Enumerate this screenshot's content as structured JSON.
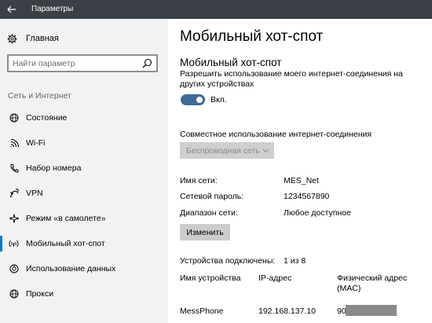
{
  "window": {
    "title": "Параметры"
  },
  "sidebar": {
    "home_label": "Главная",
    "search_placeholder": "Найти параметр",
    "section_title": "Сеть и Интернет",
    "items": [
      {
        "label": "Состояние",
        "icon": "globe-icon"
      },
      {
        "label": "Wi-Fi",
        "icon": "wifi-icon"
      },
      {
        "label": "Набор номера",
        "icon": "phone-icon"
      },
      {
        "label": "VPN",
        "icon": "vpn-icon"
      },
      {
        "label": "Режим «в самолете»",
        "icon": "airplane-icon"
      },
      {
        "label": "Мобильный хот-спот",
        "icon": "hotspot-icon",
        "active": true
      },
      {
        "label": "Использование данных",
        "icon": "data-usage-icon"
      },
      {
        "label": "Прокси",
        "icon": "globe-icon"
      }
    ]
  },
  "main": {
    "page_title": "Мобильный хот-спот",
    "sub_title": "Мобильный хот-спот",
    "description": "Разрешить использование моего интернет-соединения на других устройствах",
    "toggle": {
      "state": "on",
      "label": "Вкл."
    },
    "share_label": "Совместное использование интернет-соединения",
    "share_dropdown": "Беспроводная сеть",
    "network_name_label": "Имя сети:",
    "network_name_value": "MES_Net",
    "password_label": "Сетевой пароль:",
    "password_value": "1234567890",
    "band_label": "Диапазон сети:",
    "band_value": "Любое доступное",
    "edit_button": "Изменить",
    "connected_label": "Устройства подключены:",
    "connected_value": "1 из 8",
    "table": {
      "headers": [
        "Имя устройства",
        "IP-адрес",
        "Физический адрес (MAC)"
      ],
      "rows": [
        {
          "name": "MessPhone",
          "ip": "192.168.137.10",
          "mac": "90:"
        }
      ]
    }
  },
  "colors": {
    "titlebar": "#3a4046",
    "sidebar_bg": "#f2f2f2",
    "accent": "#0078d7",
    "toggle_on": "#3d6a94"
  }
}
